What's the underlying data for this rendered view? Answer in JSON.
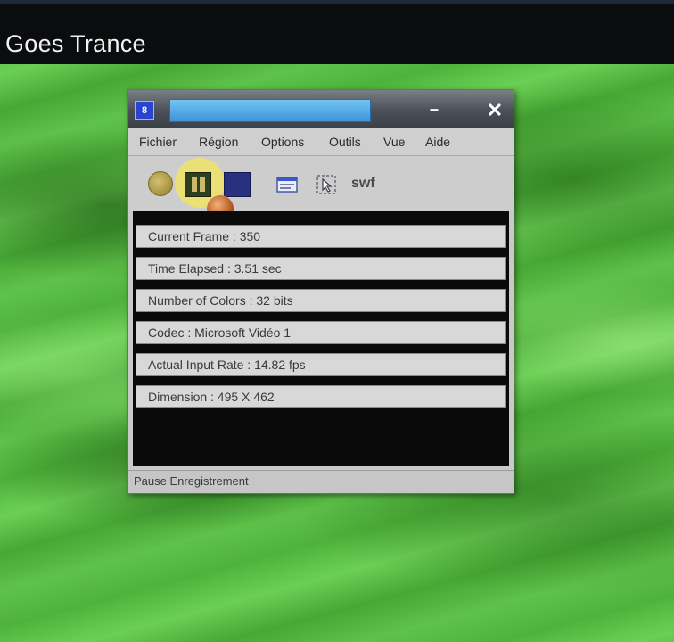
{
  "video": {
    "title": "Goes Trance"
  },
  "window": {
    "title": "",
    "app_icon_glyph": "8",
    "minimize_glyph": "–",
    "close_glyph": "✕"
  },
  "menu": {
    "items": [
      "Fichier",
      "Région",
      "Options",
      "Outils",
      "Vue",
      "Aide"
    ]
  },
  "toolbar": {
    "swf_label": "swf",
    "icons": [
      "record-icon",
      "pause-icon",
      "stop-icon",
      "region-icon",
      "cursor-icon",
      "swf-icon"
    ]
  },
  "stats": {
    "current_frame": "Current Frame : 350",
    "time_elapsed": "Time Elapsed : 3.51 sec",
    "number_of_colors": "Number of Colors : 32 bits",
    "codec": "Codec : Microsoft Vidéo 1",
    "actual_input_rate": "Actual Input Rate : 14.82 fps",
    "dimension": "Dimension : 495 X 462"
  },
  "status": {
    "text": "Pause Enregistrement"
  },
  "colors": {
    "background_green": "#5fc24a",
    "title_field_blue": "#3d94d8",
    "highlight_yellow": "#ffec3c"
  }
}
